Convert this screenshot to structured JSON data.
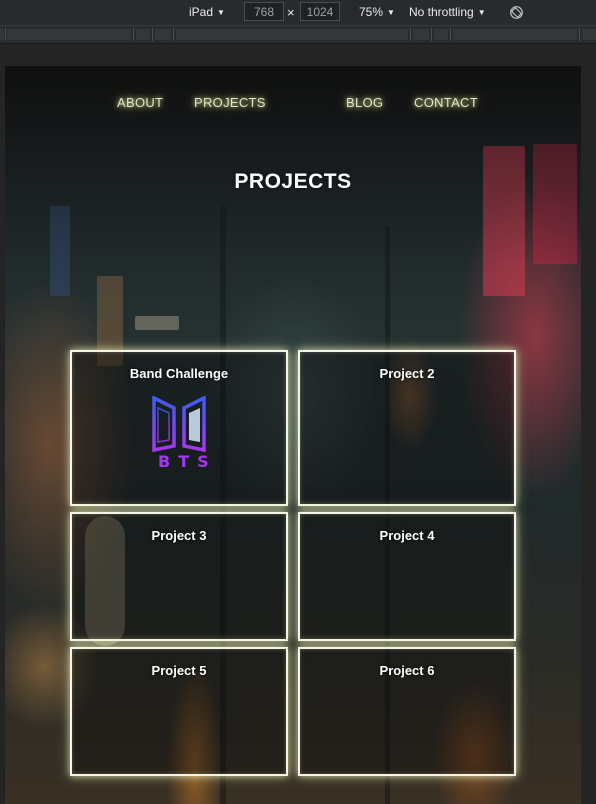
{
  "devtools": {
    "device": "iPad",
    "width": "768",
    "height": "1024",
    "times_sign": "×",
    "zoom": "75%",
    "throttling": "No throttling",
    "rotate_icon": "rotate-icon"
  },
  "nav": {
    "items": [
      "ABOUT",
      "PROJECTS",
      "BLOG",
      "CONTACT"
    ]
  },
  "page": {
    "title": "PROJECTS"
  },
  "projects": [
    {
      "title": "Band Challenge",
      "logo": "BTS"
    },
    {
      "title": "Project 2"
    },
    {
      "title": "Project 3"
    },
    {
      "title": "Project 4"
    },
    {
      "title": "Project 5"
    },
    {
      "title": "Project 6"
    }
  ],
  "colors": {
    "glow": "#e2e4c5",
    "card_border": "#f4f5e4",
    "logo_gradient_start": "#3c5cf0",
    "logo_gradient_end": "#a338f0"
  }
}
